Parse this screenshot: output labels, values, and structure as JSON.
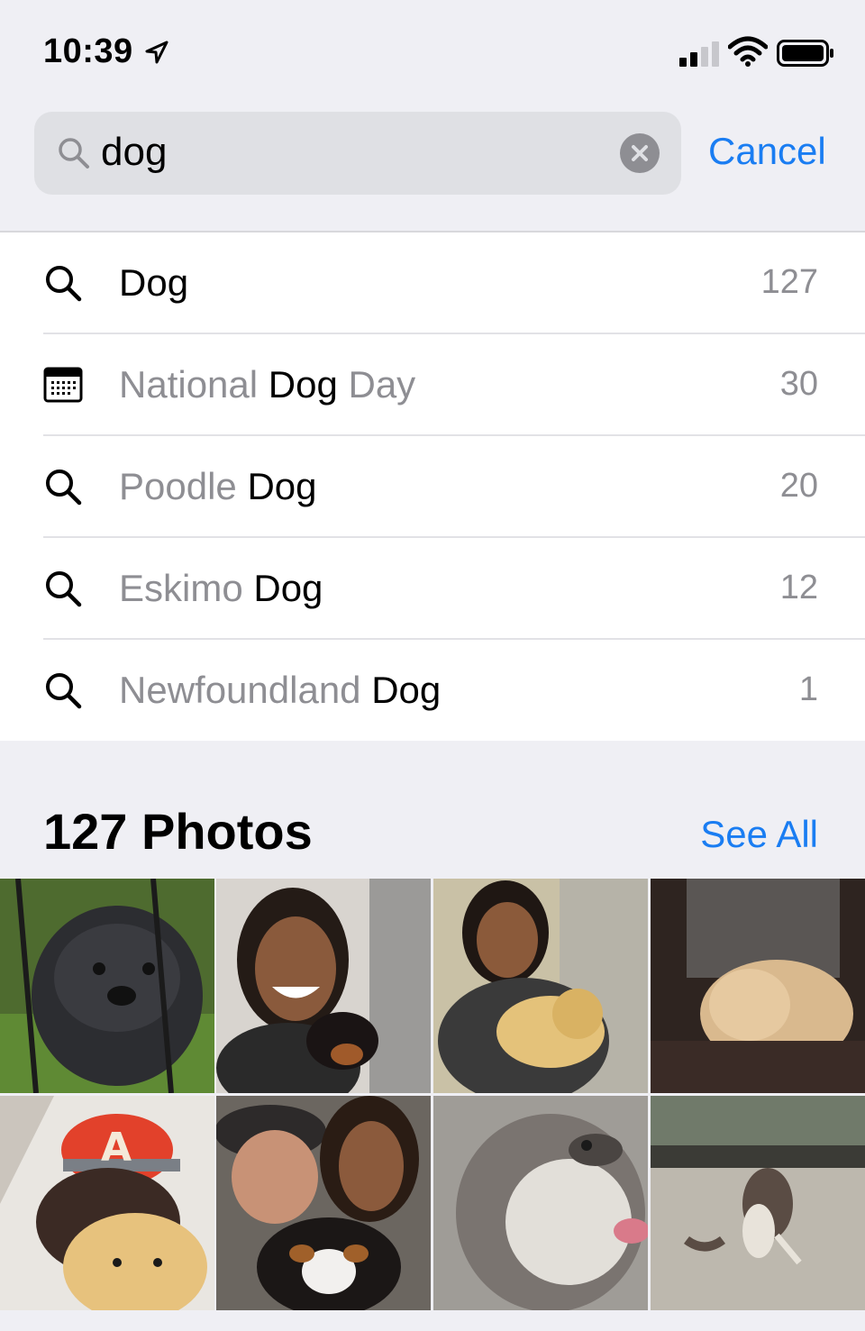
{
  "status_bar": {
    "time": "10:39"
  },
  "search": {
    "query": "dog",
    "cancel_label": "Cancel"
  },
  "results": [
    {
      "icon": "search-icon",
      "prefix": "",
      "match": "Dog",
      "suffix": "",
      "count": "127"
    },
    {
      "icon": "calendar-icon",
      "prefix": "National ",
      "match": "Dog",
      "suffix": " Day",
      "count": "30"
    },
    {
      "icon": "search-icon",
      "prefix": "Poodle ",
      "match": "Dog",
      "suffix": "",
      "count": "20"
    },
    {
      "icon": "search-icon",
      "prefix": "Eskimo ",
      "match": "Dog",
      "suffix": "",
      "count": "12"
    },
    {
      "icon": "search-icon",
      "prefix": "Newfoundland ",
      "match": "Dog",
      "suffix": "",
      "count": "1"
    }
  ],
  "photos_section": {
    "title": "127 Photos",
    "see_all_label": "See All",
    "thumbnails": [
      {
        "name": "black-puppy-photo"
      },
      {
        "name": "woman-with-puppy-photo"
      },
      {
        "name": "woman-with-golden-puppy-photo"
      },
      {
        "name": "golden-puppy-lap-photo"
      },
      {
        "name": "man-with-golden-puppy-photo"
      },
      {
        "name": "couple-with-puppy-photo"
      },
      {
        "name": "husky-closeup-photo"
      },
      {
        "name": "dog-jumping-park-photo"
      }
    ]
  },
  "colors": {
    "accent": "#1a7df2",
    "background": "#efeff4",
    "secondary_text": "#8e8e93"
  }
}
